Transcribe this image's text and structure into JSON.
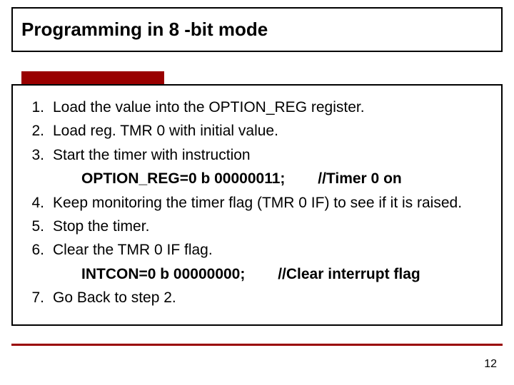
{
  "title": "Programming in 8 -bit mode",
  "steps": [
    {
      "n": "1.",
      "text": "Load the value into the OPTION_REG register."
    },
    {
      "n": "2.",
      "text": "Load reg. TMR 0 with initial value."
    },
    {
      "n": "3.",
      "text": "Start the timer with instruction"
    },
    {
      "code": "OPTION_REG=0 b 00000011;",
      "comment": "//Timer 0 on"
    },
    {
      "n": "4.",
      "text": "Keep monitoring the timer flag (TMR 0 IF) to see if it is raised."
    },
    {
      "n": "5.",
      "text": "Stop the timer."
    },
    {
      "n": "6.",
      "text": "Clear the TMR 0 IF flag."
    },
    {
      "code": "INTCON=0 b 00000000;",
      "comment": "//Clear interrupt flag"
    },
    {
      "n": "7.",
      "text": "Go Back to step 2."
    }
  ],
  "page_number": "12"
}
